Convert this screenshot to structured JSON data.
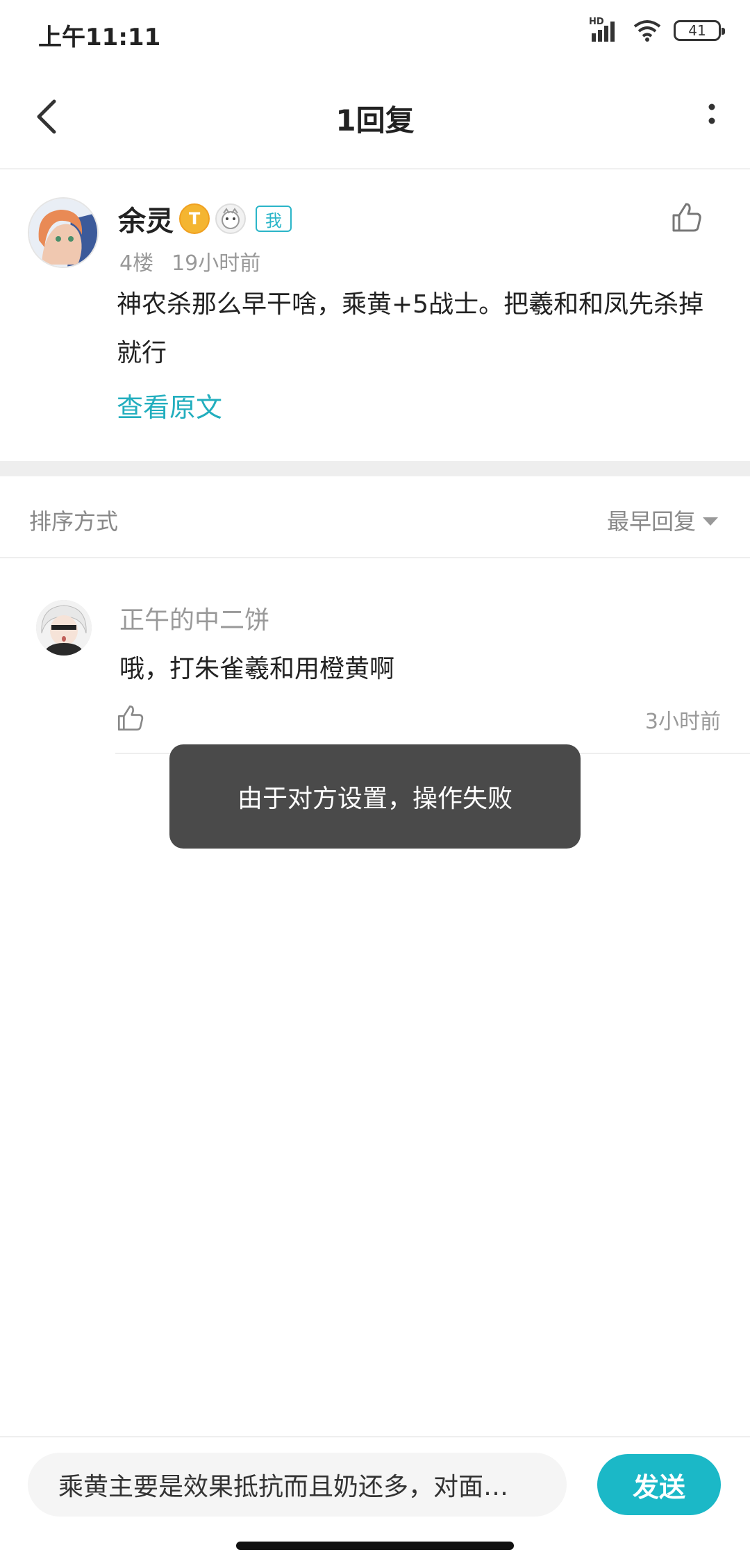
{
  "status": {
    "time": "上午11:11",
    "hd": "HD",
    "battery": "41"
  },
  "nav": {
    "title": "1回复"
  },
  "original_post": {
    "user": "余灵",
    "level_badge": "T",
    "me_tag": "我",
    "floor": "4楼",
    "time_ago": "19小时前",
    "content": "神农杀那么早干啥，乘黄+5战士。把羲和和凤先杀掉就行",
    "view_original_link": "查看原文"
  },
  "sort": {
    "label": "排序方式",
    "current": "最早回复"
  },
  "replies": [
    {
      "user": "正午的中二饼",
      "text": "哦，打朱雀羲和用橙黄啊",
      "time_ago": "3小时前"
    }
  ],
  "toast": {
    "message": "由于对方设置，操作失败"
  },
  "composer": {
    "value": "乘黄主要是效果抵抗而且奶还多，对面…",
    "send_label": "发送"
  },
  "colors": {
    "accent": "#1bb8c7",
    "toast_bg": "#4a4a4a",
    "level_gold": "#f4b531"
  }
}
